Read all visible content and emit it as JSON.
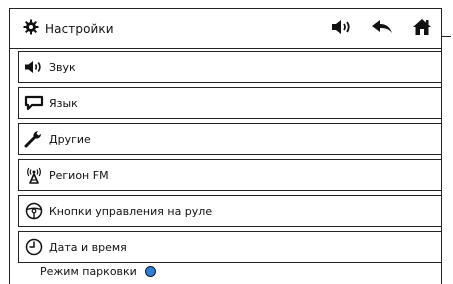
{
  "header": {
    "title": "Настройки",
    "icons": [
      "gear-icon",
      "volume-icon",
      "back-arrow-icon",
      "home-icon"
    ]
  },
  "menu": {
    "items": [
      {
        "label": "Звук",
        "icon": "volume-icon"
      },
      {
        "label": "Язык",
        "icon": "speech-bubble-icon"
      },
      {
        "label": "Другие",
        "icon": "wrench-icon"
      },
      {
        "label": "Регион FM",
        "icon": "radio-antenna-icon"
      },
      {
        "label": "Кнопки управления на руле",
        "icon": "steering-wheel-icon"
      },
      {
        "label": "Дата и время",
        "icon": "clock-icon"
      }
    ]
  },
  "parking": {
    "label": "Режим парковки",
    "indicator_color": "#2f7fd6"
  }
}
